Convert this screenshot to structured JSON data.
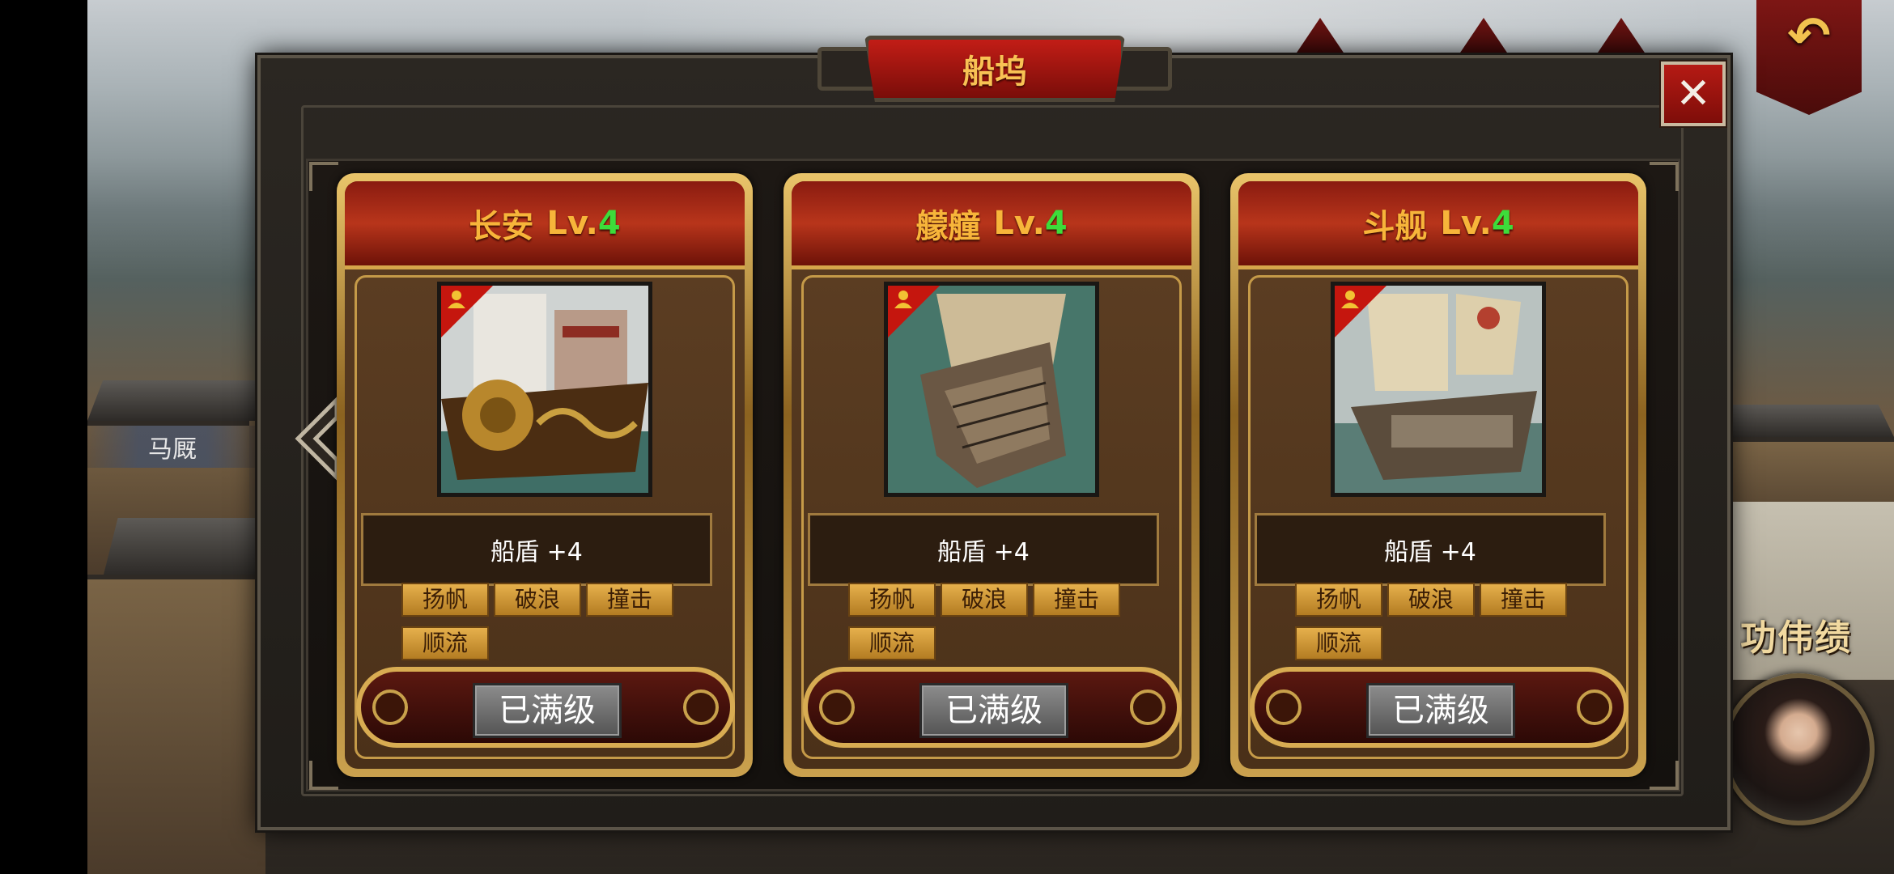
{
  "background": {
    "stable_label": "马厩",
    "exploits_label": "功伟绩"
  },
  "dialog": {
    "title": "船坞",
    "close_symbol": "✕",
    "back_symbol": "↶"
  },
  "ships": [
    {
      "name": "长安",
      "lv_prefix": "Lv.",
      "level": "4",
      "stat": "船盾 +4",
      "skills": [
        "扬帆",
        "破浪",
        "撞击",
        "顺流"
      ],
      "button": "已满级"
    },
    {
      "name": "艨艟",
      "lv_prefix": "Lv.",
      "level": "4",
      "stat": "船盾 +4",
      "skills": [
        "扬帆",
        "破浪",
        "撞击",
        "顺流"
      ],
      "button": "已满级"
    },
    {
      "name": "斗舰",
      "lv_prefix": "Lv.",
      "level": "4",
      "stat": "船盾 +4",
      "skills": [
        "扬帆",
        "破浪",
        "撞击",
        "顺流"
      ],
      "button": "已满级"
    }
  ],
  "colors": {
    "title_text": "#f8c254",
    "ship_name": "#f7b53a",
    "level_number": "#3ddc3a",
    "close_red": "#b51a14"
  },
  "icons": {
    "close": "close-icon",
    "back": "back-arrow-icon",
    "prev": "chevron-left-icon",
    "role": "person-icon"
  }
}
